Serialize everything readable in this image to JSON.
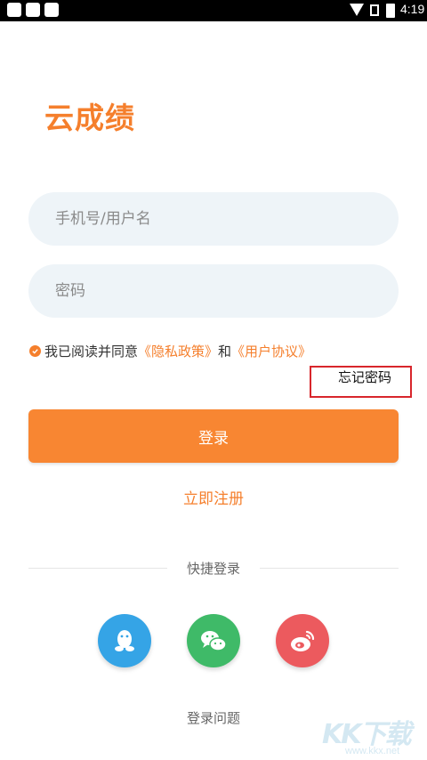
{
  "status_bar": {
    "time": "4:19"
  },
  "app": {
    "logo_text": "云成绩"
  },
  "form": {
    "phone_placeholder": "手机号/用户名",
    "password_placeholder": "密码",
    "agreement": {
      "prefix": "我已阅读并同意",
      "privacy_link": "《隐私政策》",
      "conjunction": "和",
      "terms_link": "《用户协议》"
    },
    "forgot_password": "忘记密码",
    "login_button": "登录",
    "register_link": "立即注册"
  },
  "quick_login": {
    "label": "快捷登录",
    "providers": [
      "qq-icon",
      "wechat-icon",
      "weibo-icon"
    ]
  },
  "footer": {
    "help_link": "登录问题"
  },
  "watermark": {
    "text": "KK下载",
    "url": "www.kkx.net"
  },
  "colors": {
    "accent": "#f57f2c",
    "login_button": "#f88632",
    "qq": "#35a4e6",
    "wechat": "#3fba68",
    "weibo": "#ec5a5e"
  }
}
